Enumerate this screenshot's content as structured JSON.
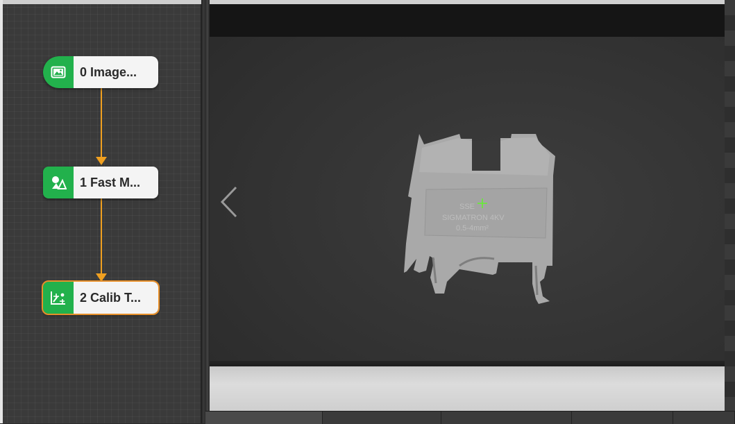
{
  "flow": {
    "nodes": [
      {
        "label": "0 Image...",
        "icon": "image-icon",
        "selected": false
      },
      {
        "label": "1 Fast M...",
        "icon": "shape-match-icon",
        "selected": false
      },
      {
        "label": "2 Calib T...",
        "icon": "calibration-transform-icon",
        "selected": true
      }
    ],
    "connector_color": "#f0a020",
    "badge_color": "#22b14c",
    "selected_outline": "#e8902a"
  },
  "viewer": {
    "nav_prev_icon": "chevron-left-icon",
    "crosshair_icon": "crosshair-icon",
    "crosshair_color": "#66ee33"
  },
  "bottom_tabs": [
    "",
    "",
    "",
    "",
    ""
  ]
}
